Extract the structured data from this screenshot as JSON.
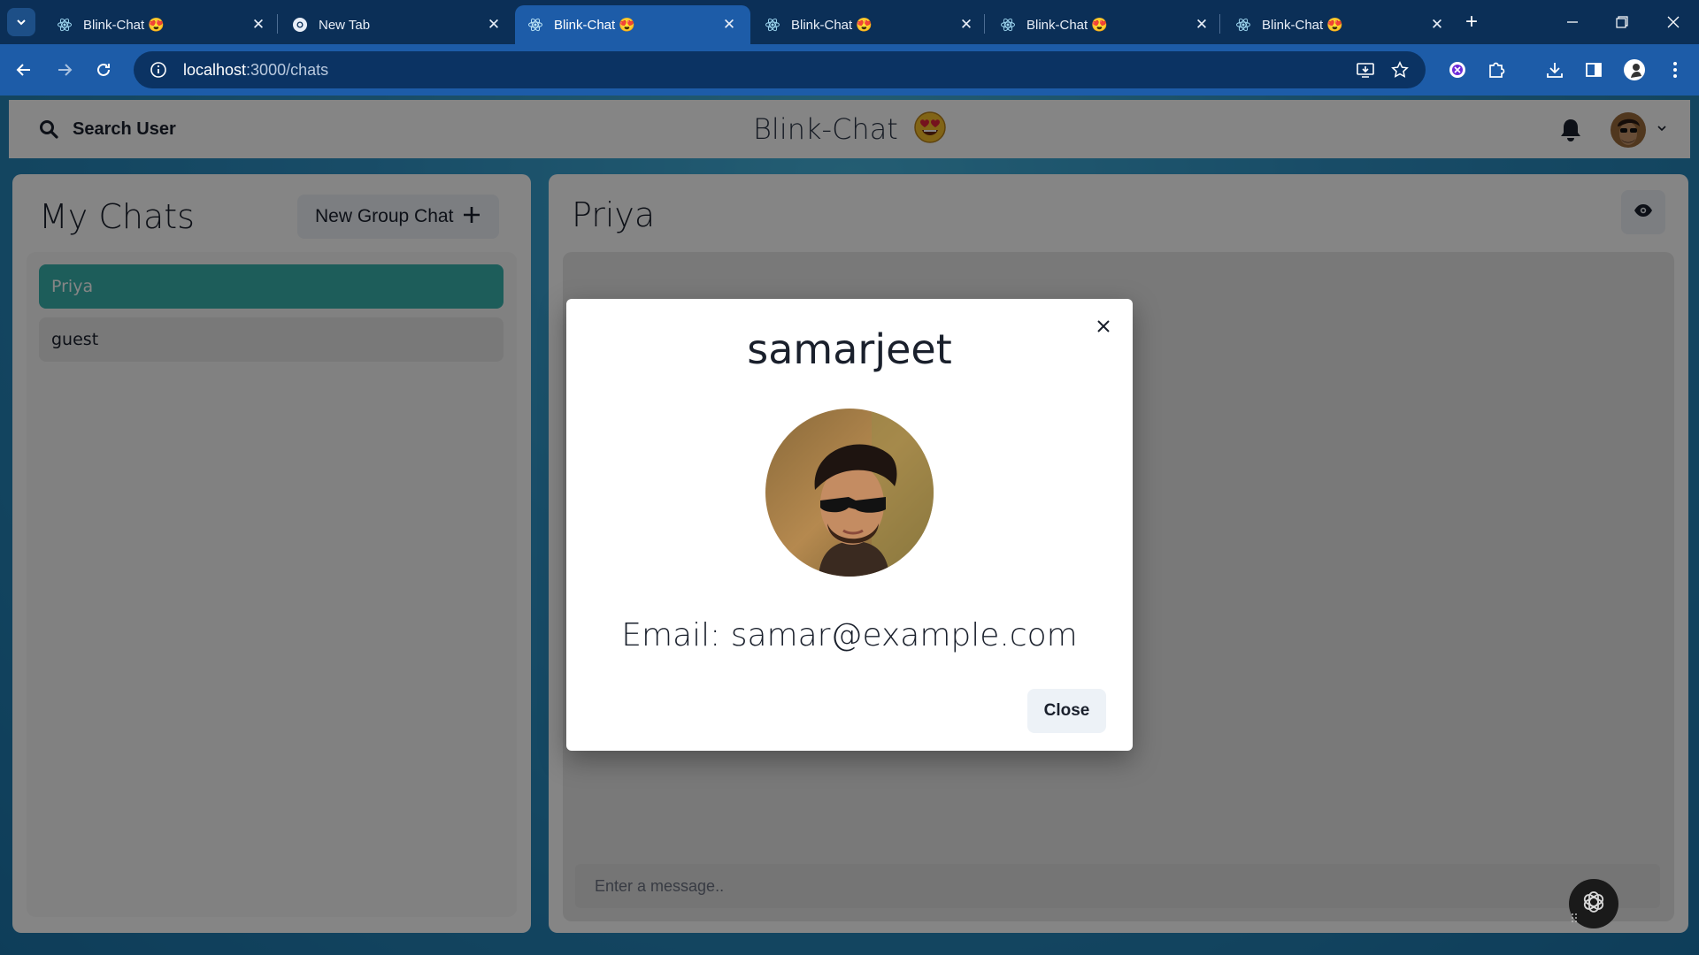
{
  "browser": {
    "tabs": [
      {
        "title": "Blink-Chat 😍",
        "icon": "react-icon",
        "active": false
      },
      {
        "title": "New Tab",
        "icon": "chrome-icon",
        "active": false
      },
      {
        "title": "Blink-Chat 😍",
        "icon": "react-icon",
        "active": true
      },
      {
        "title": "Blink-Chat 😍",
        "icon": "react-icon",
        "active": false
      },
      {
        "title": "Blink-Chat 😍",
        "icon": "react-icon",
        "active": false
      },
      {
        "title": "Blink-Chat 😍",
        "icon": "react-icon",
        "active": false
      }
    ],
    "url_host": "localhost",
    "url_path": ":3000/chats"
  },
  "app": {
    "search_label": "Search User",
    "brand_title": "Blink-Chat",
    "my_chats_title": "My Chats",
    "new_group_label": "New Group Chat",
    "chats": [
      {
        "name": "Priya",
        "selected": true
      },
      {
        "name": "guest",
        "selected": false
      }
    ],
    "active_chat_title": "Priya",
    "message_placeholder": "Enter a message.."
  },
  "modal": {
    "title": "samarjeet",
    "email_text": "Email: samar@example.com",
    "close_label": "Close"
  },
  "colors": {
    "tabbar": "#0b2f57",
    "toolbar": "#1d5ca8",
    "accent_teal": "#38b2ac",
    "background": "#2f93c6"
  }
}
